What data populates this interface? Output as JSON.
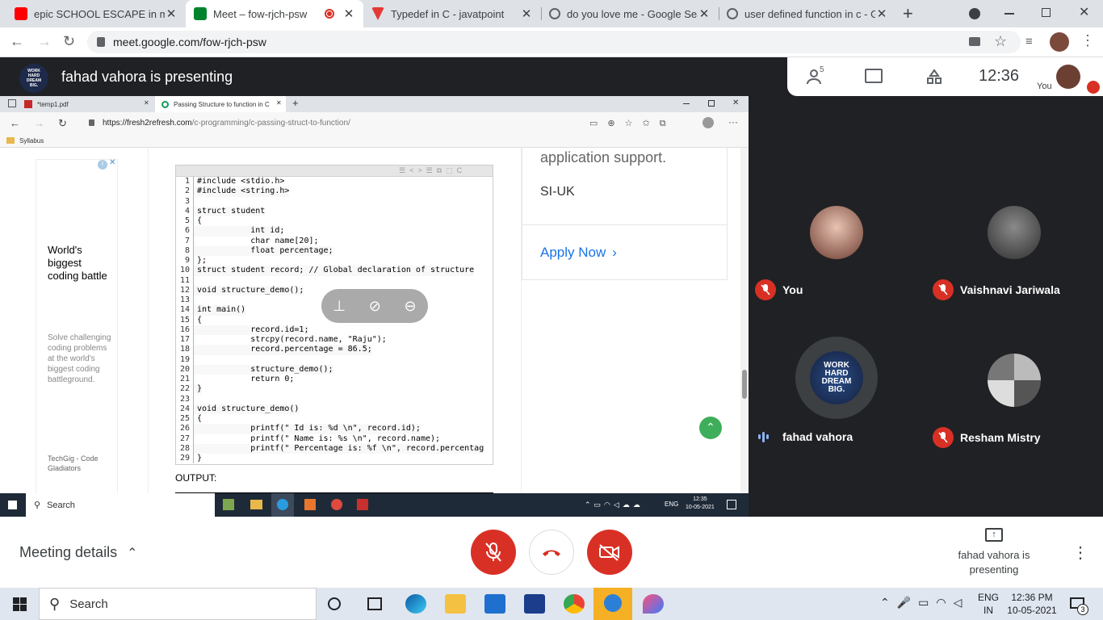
{
  "browser": {
    "tabs": [
      {
        "title": "epic SCHOOL ESCAPE in minecra",
        "icon": "youtube-icon",
        "color": "#ff0000"
      },
      {
        "title": "Meet – fow-rjch-psw",
        "icon": "google-meet-icon",
        "color": "#00832d",
        "active": true
      },
      {
        "title": "Typedef in C - javatpoint",
        "icon": "javatpoint-icon",
        "color": "#e53935"
      },
      {
        "title": "do you love me - Google Sear",
        "icon": "google-icon",
        "color": "#4285f4"
      },
      {
        "title": "user defined function in c - Go",
        "icon": "google-icon",
        "color": "#4285f4"
      }
    ],
    "url": "meet.google.com/fow-rjch-psw"
  },
  "meet": {
    "presenter_banner": "fahad vahora is presenting",
    "participants_count": "5",
    "clock": "12:36",
    "you_label": "You",
    "meeting_details": "Meeting details",
    "presenting_label": "fahad vahora is presenting"
  },
  "shared_screen": {
    "tabs": [
      {
        "title": "*temp1.pdf"
      },
      {
        "title": "Passing Structure to function in C"
      }
    ],
    "url_prefix": "https://fresh2refresh.com",
    "url_path": "/c-programming/c-passing-struct-to-function/",
    "favorites": "Syllabus",
    "ad": {
      "headline": "World's biggest coding battle",
      "body": "Solve challenging coding problems at the world's biggest coding battleground.",
      "footer": "TechGig - Code Gladiators"
    },
    "right_card": {
      "text": "application support.",
      "company": "SI-UK",
      "cta": "Apply Now"
    },
    "code_lines": [
      "#include <stdio.h>",
      "#include <string.h>",
      "",
      "struct student",
      "{",
      "           int id;",
      "           char name[20];",
      "           float percentage;",
      "};",
      "struct student record; // Global declaration of structure",
      "",
      "void structure_demo();",
      "",
      "int main()",
      "{",
      "           record.id=1;",
      "           strcpy(record.name, \"Raju\");",
      "           record.percentage = 86.5;",
      "",
      "           structure_demo();",
      "           return 0;",
      "}",
      "",
      "void structure_demo()",
      "{",
      "           printf(\" Id is: %d \\n\", record.id);",
      "           printf(\" Name is: %s \\n\", record.name);",
      "           printf(\" Percentage is: %f \\n\", record.percentag",
      "}"
    ],
    "output_label": "OUTPUT:",
    "taskbar": {
      "search": "Search",
      "lang": "ENG",
      "time": "12:35",
      "date": "10-05-2021"
    }
  },
  "participants": [
    {
      "name": "You",
      "muted": true
    },
    {
      "name": "Vaishnavi Jariwala",
      "muted": true
    },
    {
      "name": "fahad vahora",
      "muted": false,
      "speaking": true,
      "avatar_text": "WORK HARD DREAM BIG."
    },
    {
      "name": "Resham Mistry",
      "muted": true
    }
  ],
  "windows_taskbar": {
    "search": "Search",
    "lang_top": "ENG",
    "lang_bottom": "IN",
    "time": "12:36 PM",
    "date": "10-05-2021",
    "notifications": "3"
  },
  "colors": {
    "red": "#d93025",
    "meet_dark": "#202124",
    "link_blue": "#1a73e8"
  }
}
